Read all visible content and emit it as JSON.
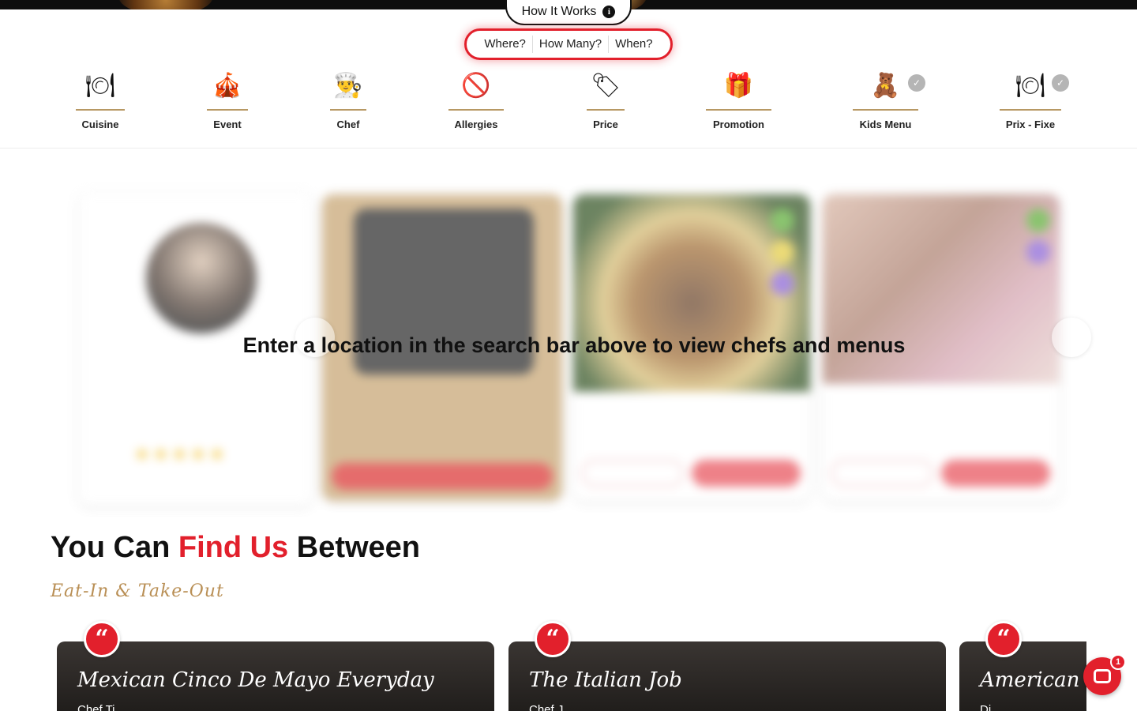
{
  "header": {
    "how_it_works": "How It Works",
    "info_icon": "i"
  },
  "search": {
    "where": "Where?",
    "how_many": "How Many?",
    "when": "When?"
  },
  "filters": [
    {
      "label": "Cuisine",
      "icon": "cloche-icon",
      "glyph": "🍽",
      "checked": false
    },
    {
      "label": "Event",
      "icon": "event-icon",
      "glyph": "🎪",
      "checked": false
    },
    {
      "label": "Chef",
      "icon": "chef-icon",
      "glyph": "👨‍🍳",
      "checked": false
    },
    {
      "label": "Allergies",
      "icon": "allergies-icon",
      "glyph": "🚫",
      "checked": false
    },
    {
      "label": "Price",
      "icon": "price-tag-icon",
      "glyph": "🏷",
      "checked": false
    },
    {
      "label": "Promotion",
      "icon": "gift-icon",
      "glyph": "🎁",
      "checked": false
    },
    {
      "label": "Kids Menu",
      "icon": "teddy-bear-icon",
      "glyph": "🧸",
      "checked": true
    },
    {
      "label": "Prix - Fixe",
      "icon": "dinner-plate-icon",
      "glyph": "🍽",
      "checked": true
    }
  ],
  "carousel": {
    "message": "Enter a location in the search bar above to view chefs and menus"
  },
  "find_us": {
    "title_pre": "You Can ",
    "title_highlight": "Find Us",
    "title_post": " Between",
    "subtitle": "Eat-In & Take-Out"
  },
  "stories": [
    {
      "title": "Mexican Cinco De Mayo Everyday",
      "body": "Chef Ti..."
    },
    {
      "title": "The Italian Job",
      "body": "Chef J..."
    },
    {
      "title": "American C",
      "body": "Di..."
    }
  ],
  "chat": {
    "badge": "1"
  },
  "colors": {
    "accent": "#e2202c",
    "gold": "#b79863"
  }
}
